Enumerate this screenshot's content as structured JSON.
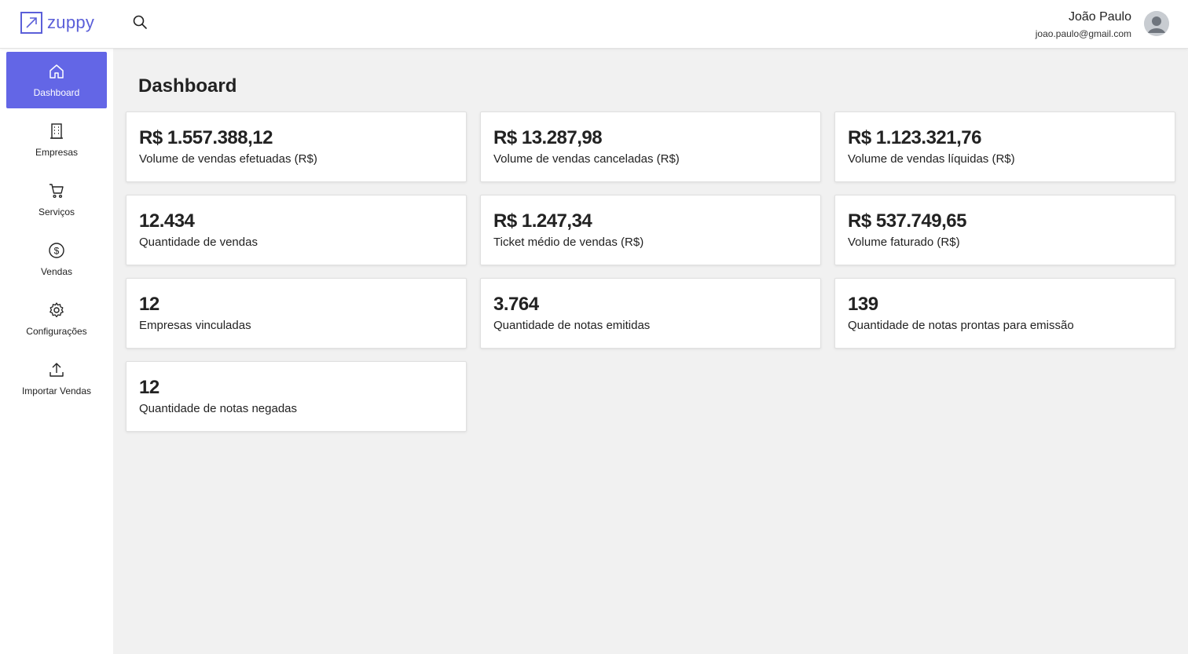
{
  "app": {
    "logo_text": "zuppy"
  },
  "user": {
    "name": "João Paulo",
    "email": "joao.paulo@gmail.com"
  },
  "sidebar": {
    "items": [
      {
        "label": "Dashboard",
        "icon": "home-icon",
        "active": true
      },
      {
        "label": "Empresas",
        "icon": "building-icon"
      },
      {
        "label": "Serviços",
        "icon": "cart-icon"
      },
      {
        "label": "Vendas",
        "icon": "dollar-circle-icon"
      },
      {
        "label": "Configurações",
        "icon": "gear-icon"
      },
      {
        "label": "Importar Vendas",
        "icon": "upload-icon"
      }
    ]
  },
  "main": {
    "title": "Dashboard",
    "cards": [
      {
        "value": "R$ 1.557.388,12",
        "label": "Volume de vendas efetuadas (R$)"
      },
      {
        "value": "R$ 13.287,98",
        "label": "Volume de vendas canceladas (R$)"
      },
      {
        "value": "R$ 1.123.321,76",
        "label": "Volume de vendas líquidas (R$)"
      },
      {
        "value": "12.434",
        "label": "Quantidade de vendas"
      },
      {
        "value": "R$ 1.247,34",
        "label": "Ticket médio de vendas (R$)"
      },
      {
        "value": "R$ 537.749,65",
        "label": "Volume faturado (R$)"
      },
      {
        "value": "12",
        "label": "Empresas vinculadas"
      },
      {
        "value": "3.764",
        "label": "Quantidade de notas emitidas"
      },
      {
        "value": "139",
        "label": "Quantidade de notas prontas para emissão"
      },
      {
        "value": "12",
        "label": "Quantidade de notas negadas"
      }
    ]
  },
  "colors": {
    "accent": "#6366e6",
    "brand": "#5b5fd9",
    "background": "#f1f1f1"
  }
}
